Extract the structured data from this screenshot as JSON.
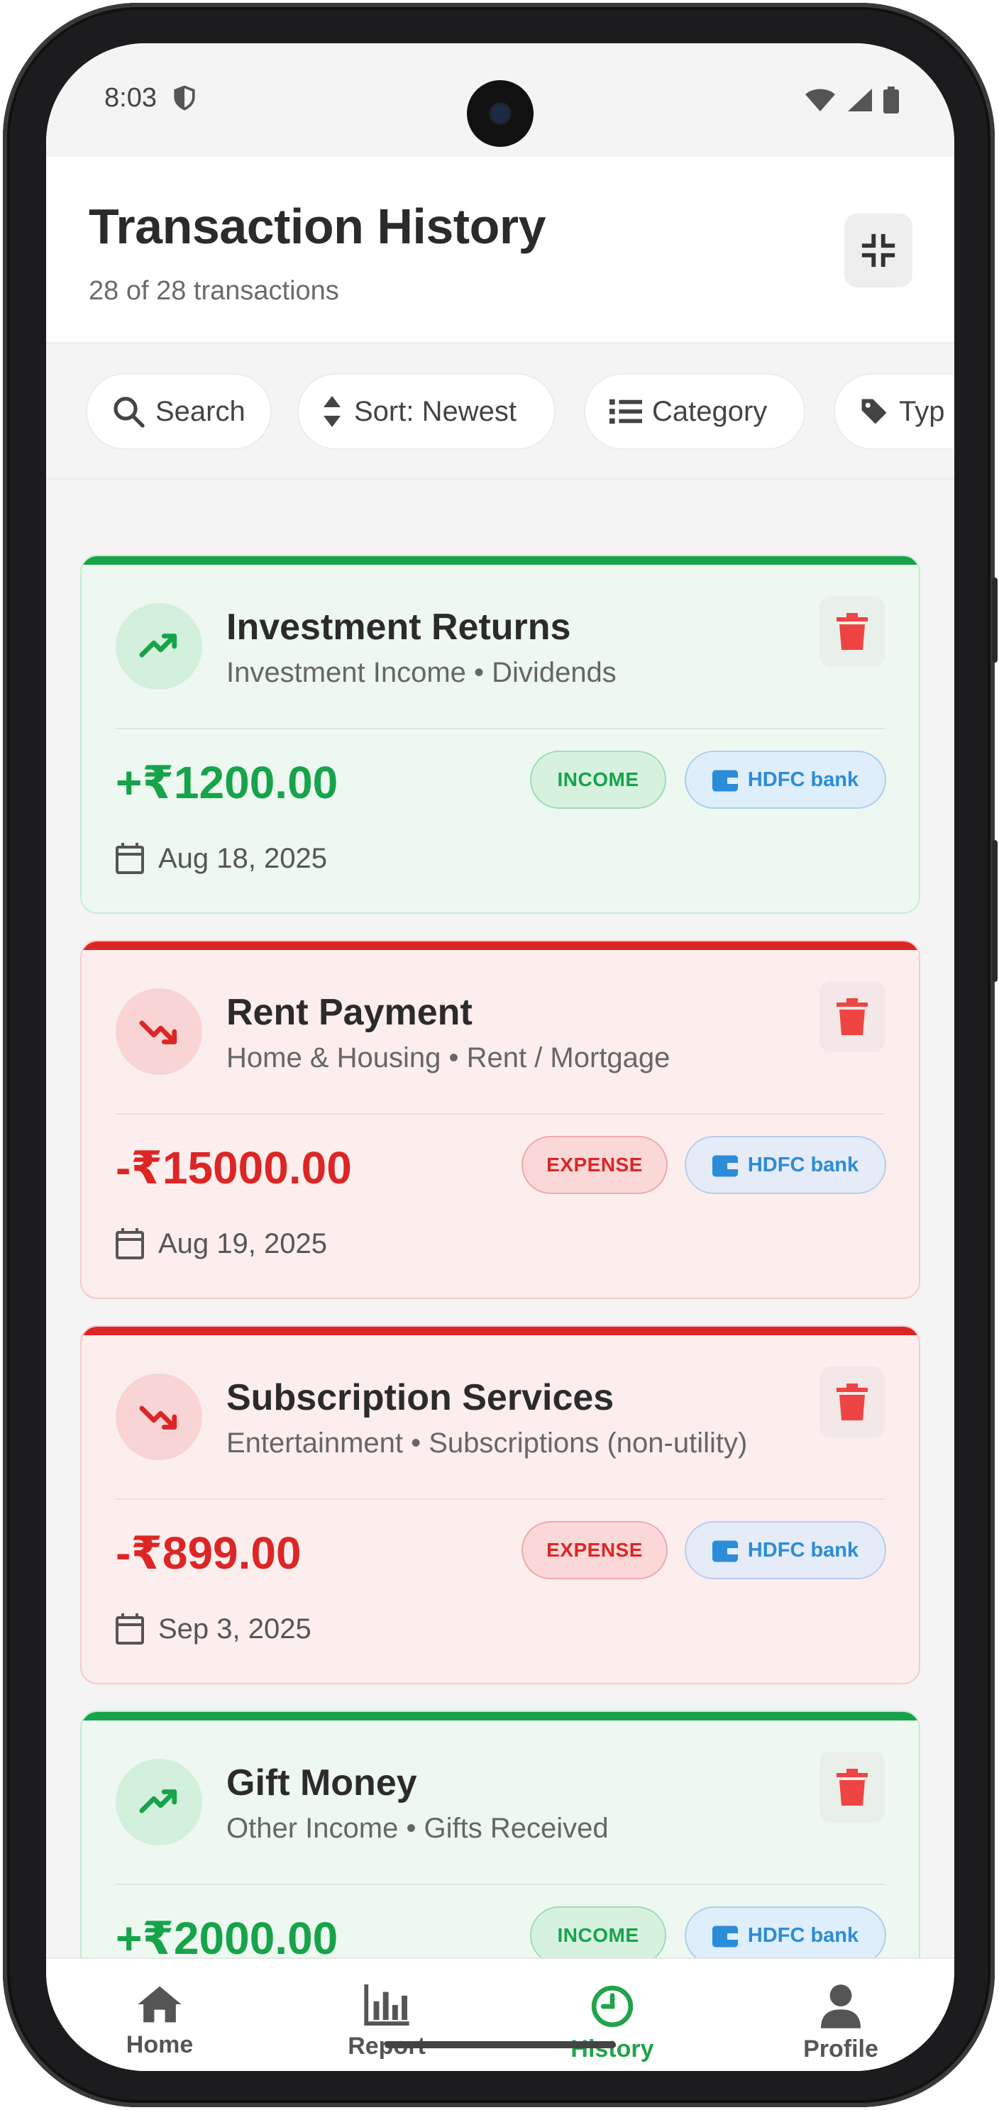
{
  "status_bar": {
    "time": "8:03"
  },
  "header": {
    "title": "Transaction History",
    "subtitle": "28 of 28 transactions"
  },
  "filters": [
    {
      "label": "Search",
      "icon": "search-icon"
    },
    {
      "label": "Sort: Newest",
      "icon": "sort-icon"
    },
    {
      "label": "Category",
      "icon": "list-icon"
    },
    {
      "label": "Typ",
      "icon": "tag-icon"
    }
  ],
  "transactions": [
    {
      "title": "Investment Returns",
      "category": "Investment Income • Dividends",
      "amount": "+₹1200.00",
      "type": "INCOME",
      "account": "HDFC bank",
      "date": "Aug 18, 2025"
    },
    {
      "title": "Rent Payment",
      "category": "Home & Housing • Rent / Mortgage",
      "amount": "-₹15000.00",
      "type": "EXPENSE",
      "account": "HDFC bank",
      "date": "Aug 19, 2025"
    },
    {
      "title": "Subscription Services",
      "category": "Entertainment • Subscriptions (non-utility)",
      "amount": "-₹899.00",
      "type": "EXPENSE",
      "account": "HDFC bank",
      "date": "Sep 3, 2025"
    },
    {
      "title": "Gift Money",
      "category": "Other Income • Gifts Received",
      "amount": "+₹2000.00",
      "type": "INCOME",
      "account": "HDFC bank",
      "date": ""
    }
  ],
  "nav": [
    {
      "label": "Home",
      "icon": "home-icon"
    },
    {
      "label": "Report",
      "icon": "bar-chart-icon"
    },
    {
      "label": "History",
      "icon": "clock-icon",
      "active": true
    },
    {
      "label": "Profile",
      "icon": "person-icon"
    }
  ],
  "colors": {
    "income": "#16a34a",
    "expense": "#dc2626",
    "accent_blue": "#2b8cd8",
    "active_nav": "#22a34a"
  }
}
